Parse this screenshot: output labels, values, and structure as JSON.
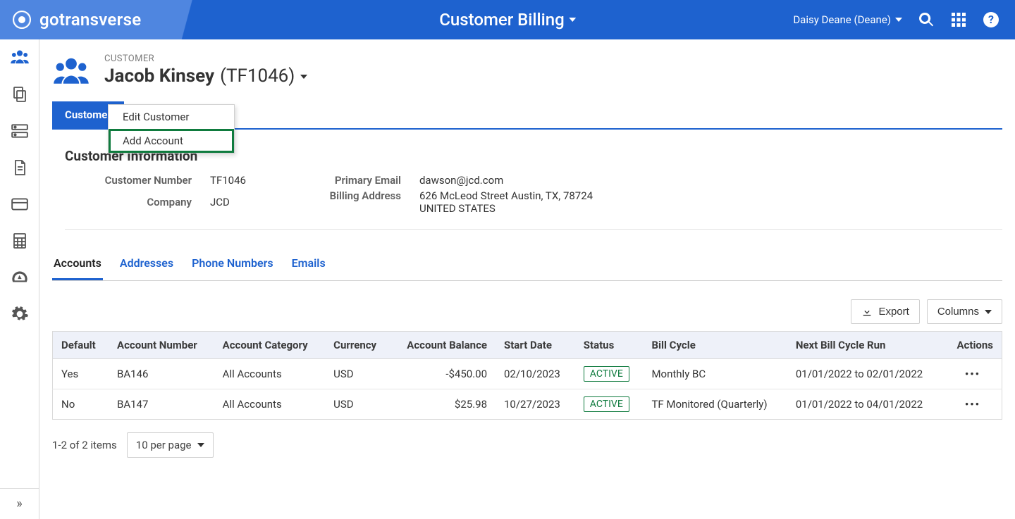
{
  "header": {
    "brand": "gotransverse",
    "title": "Customer Billing",
    "user_label": "Daisy Deane (Deane)"
  },
  "sidebar": {
    "toggle_glyph": "»"
  },
  "customer": {
    "eyebrow": "CUSTOMER",
    "name": "Jacob Kinsey",
    "id_paren": "(TF1046)"
  },
  "primary_tab": "Customer",
  "dropdown": {
    "edit": "Edit Customer",
    "add": "Add Account"
  },
  "info": {
    "heading": "Customer Information",
    "number_label": "Customer Number",
    "number_value": "TF1046",
    "company_label": "Company",
    "company_value": "JCD",
    "email_label": "Primary Email",
    "email_value": "dawson@jcd.com",
    "addr_label": "Billing Address",
    "addr_value": "626 McLeod Street Austin, TX, 78724 UNITED STATES"
  },
  "subtabs": {
    "accounts": "Accounts",
    "addresses": "Addresses",
    "phone": "Phone Numbers",
    "emails": "Emails"
  },
  "toolbar": {
    "export": "Export",
    "columns": "Columns"
  },
  "table": {
    "headers": {
      "default": "Default",
      "account_number": "Account Number",
      "account_category": "Account Category",
      "currency": "Currency",
      "account_balance": "Account Balance",
      "start_date": "Start Date",
      "status": "Status",
      "bill_cycle": "Bill Cycle",
      "next_run": "Next Bill Cycle Run",
      "actions": "Actions"
    },
    "rows": [
      {
        "default": "Yes",
        "account_number": "BA146",
        "account_category": "All Accounts",
        "currency": "USD",
        "account_balance": "-$450.00",
        "start_date": "02/10/2023",
        "status": "ACTIVE",
        "bill_cycle": "Monthly BC",
        "next_run": "01/01/2022 to 02/01/2022"
      },
      {
        "default": "No",
        "account_number": "BA147",
        "account_category": "All Accounts",
        "currency": "USD",
        "account_balance": "$25.98",
        "start_date": "10/27/2023",
        "status": "ACTIVE",
        "bill_cycle": "TF Monitored (Quarterly)",
        "next_run": "01/01/2022 to 04/01/2022"
      }
    ]
  },
  "pagination": {
    "summary": "1-2 of 2 items",
    "page_size": "10 per page"
  },
  "colors": {
    "primary": "#1e62cf",
    "accent": "#4f86e0",
    "success": "#0f7b3e"
  }
}
